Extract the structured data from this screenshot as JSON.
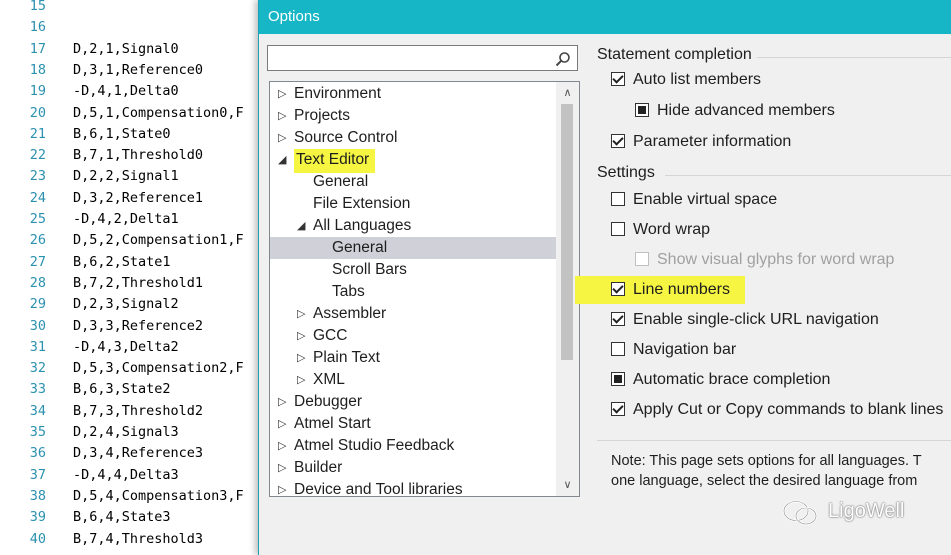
{
  "editor": {
    "lines": [
      {
        "num": "15",
        "code": ""
      },
      {
        "num": "16",
        "code": ""
      },
      {
        "num": "17",
        "code": "D,2,1,Signal0"
      },
      {
        "num": "18",
        "code": "D,3,1,Reference0"
      },
      {
        "num": "19",
        "code": "-D,4,1,Delta0"
      },
      {
        "num": "20",
        "code": "D,5,1,Compensation0,F"
      },
      {
        "num": "21",
        "code": "B,6,1,State0"
      },
      {
        "num": "22",
        "code": "B,7,1,Threshold0"
      },
      {
        "num": "23",
        "code": "D,2,2,Signal1"
      },
      {
        "num": "24",
        "code": "D,3,2,Reference1"
      },
      {
        "num": "25",
        "code": "-D,4,2,Delta1"
      },
      {
        "num": "26",
        "code": "D,5,2,Compensation1,F"
      },
      {
        "num": "27",
        "code": "B,6,2,State1"
      },
      {
        "num": "28",
        "code": "B,7,2,Threshold1"
      },
      {
        "num": "29",
        "code": "D,2,3,Signal2"
      },
      {
        "num": "30",
        "code": "D,3,3,Reference2"
      },
      {
        "num": "31",
        "code": "-D,4,3,Delta2"
      },
      {
        "num": "32",
        "code": "D,5,3,Compensation2,F"
      },
      {
        "num": "33",
        "code": "B,6,3,State2"
      },
      {
        "num": "34",
        "code": "B,7,3,Threshold2"
      },
      {
        "num": "35",
        "code": "D,2,4,Signal3"
      },
      {
        "num": "36",
        "code": "D,3,4,Reference3"
      },
      {
        "num": "37",
        "code": "-D,4,4,Delta3"
      },
      {
        "num": "38",
        "code": "D,5,4,Compensation3,F"
      },
      {
        "num": "39",
        "code": "B,6,4,State3"
      },
      {
        "num": "40",
        "code": "B,7,4,Threshold3"
      }
    ]
  },
  "dialog": {
    "title": "Options",
    "search": {
      "value": "",
      "placeholder": ""
    },
    "tree": [
      {
        "label": "Environment",
        "arrow": "collapsed",
        "indent": 0
      },
      {
        "label": "Projects",
        "arrow": "collapsed",
        "indent": 0
      },
      {
        "label": "Source Control",
        "arrow": "collapsed",
        "indent": 0
      },
      {
        "label": "Text Editor",
        "arrow": "expanded",
        "indent": 0,
        "highlight": true
      },
      {
        "label": "General",
        "arrow": "none",
        "indent": 1
      },
      {
        "label": "File Extension",
        "arrow": "none",
        "indent": 1
      },
      {
        "label": "All Languages",
        "arrow": "expanded",
        "indent": 1
      },
      {
        "label": "General",
        "arrow": "none",
        "indent": 2,
        "selected": true
      },
      {
        "label": "Scroll Bars",
        "arrow": "none",
        "indent": 2
      },
      {
        "label": "Tabs",
        "arrow": "none",
        "indent": 2
      },
      {
        "label": "Assembler",
        "arrow": "collapsed",
        "indent": 1
      },
      {
        "label": "GCC",
        "arrow": "collapsed",
        "indent": 1
      },
      {
        "label": "Plain Text",
        "arrow": "collapsed",
        "indent": 1
      },
      {
        "label": "XML",
        "arrow": "collapsed",
        "indent": 1
      },
      {
        "label": "Debugger",
        "arrow": "collapsed",
        "indent": 0
      },
      {
        "label": "Atmel Start",
        "arrow": "collapsed",
        "indent": 0
      },
      {
        "label": "Atmel Studio Feedback",
        "arrow": "collapsed",
        "indent": 0
      },
      {
        "label": "Builder",
        "arrow": "collapsed",
        "indent": 0
      },
      {
        "label": "Device and Tool libraries",
        "arrow": "collapsed",
        "indent": 0
      }
    ],
    "statement_completion": {
      "header": "Statement completion",
      "options": [
        {
          "label": "Auto list members",
          "state": "checked",
          "indent": 0
        },
        {
          "label": "Hide advanced members",
          "state": "indeterminate",
          "indent": 1
        },
        {
          "label": "Parameter information",
          "state": "checked",
          "indent": 0
        }
      ]
    },
    "settings": {
      "header": "Settings",
      "options": [
        {
          "label": "Enable virtual space",
          "state": "unchecked",
          "indent": 0
        },
        {
          "label": "Word wrap",
          "state": "unchecked",
          "indent": 0
        },
        {
          "label": "Show visual glyphs for word wrap",
          "state": "unchecked",
          "indent": 1,
          "disabled": true
        },
        {
          "label": "Line numbers",
          "state": "checked",
          "indent": 0,
          "highlight": true
        },
        {
          "label": "Enable single-click URL navigation",
          "state": "checked",
          "indent": 0
        },
        {
          "label": "Navigation bar",
          "state": "unchecked",
          "indent": 0
        },
        {
          "label": "Automatic brace completion",
          "state": "indeterminate",
          "indent": 0
        },
        {
          "label": "Apply Cut or Copy commands to blank lines",
          "state": "checked",
          "indent": 0
        }
      ]
    },
    "note": {
      "line1": "Note: This page sets options for all languages. T",
      "line2": "one language, select the desired language from"
    }
  },
  "watermark": {
    "text": "LigoWell",
    "icon": "wechat-icon"
  },
  "colors": {
    "titlebar": "#17b6c6",
    "highlight": "#f5f542",
    "line_numbers": "#2b91af",
    "selection": "#d0d0d8"
  }
}
